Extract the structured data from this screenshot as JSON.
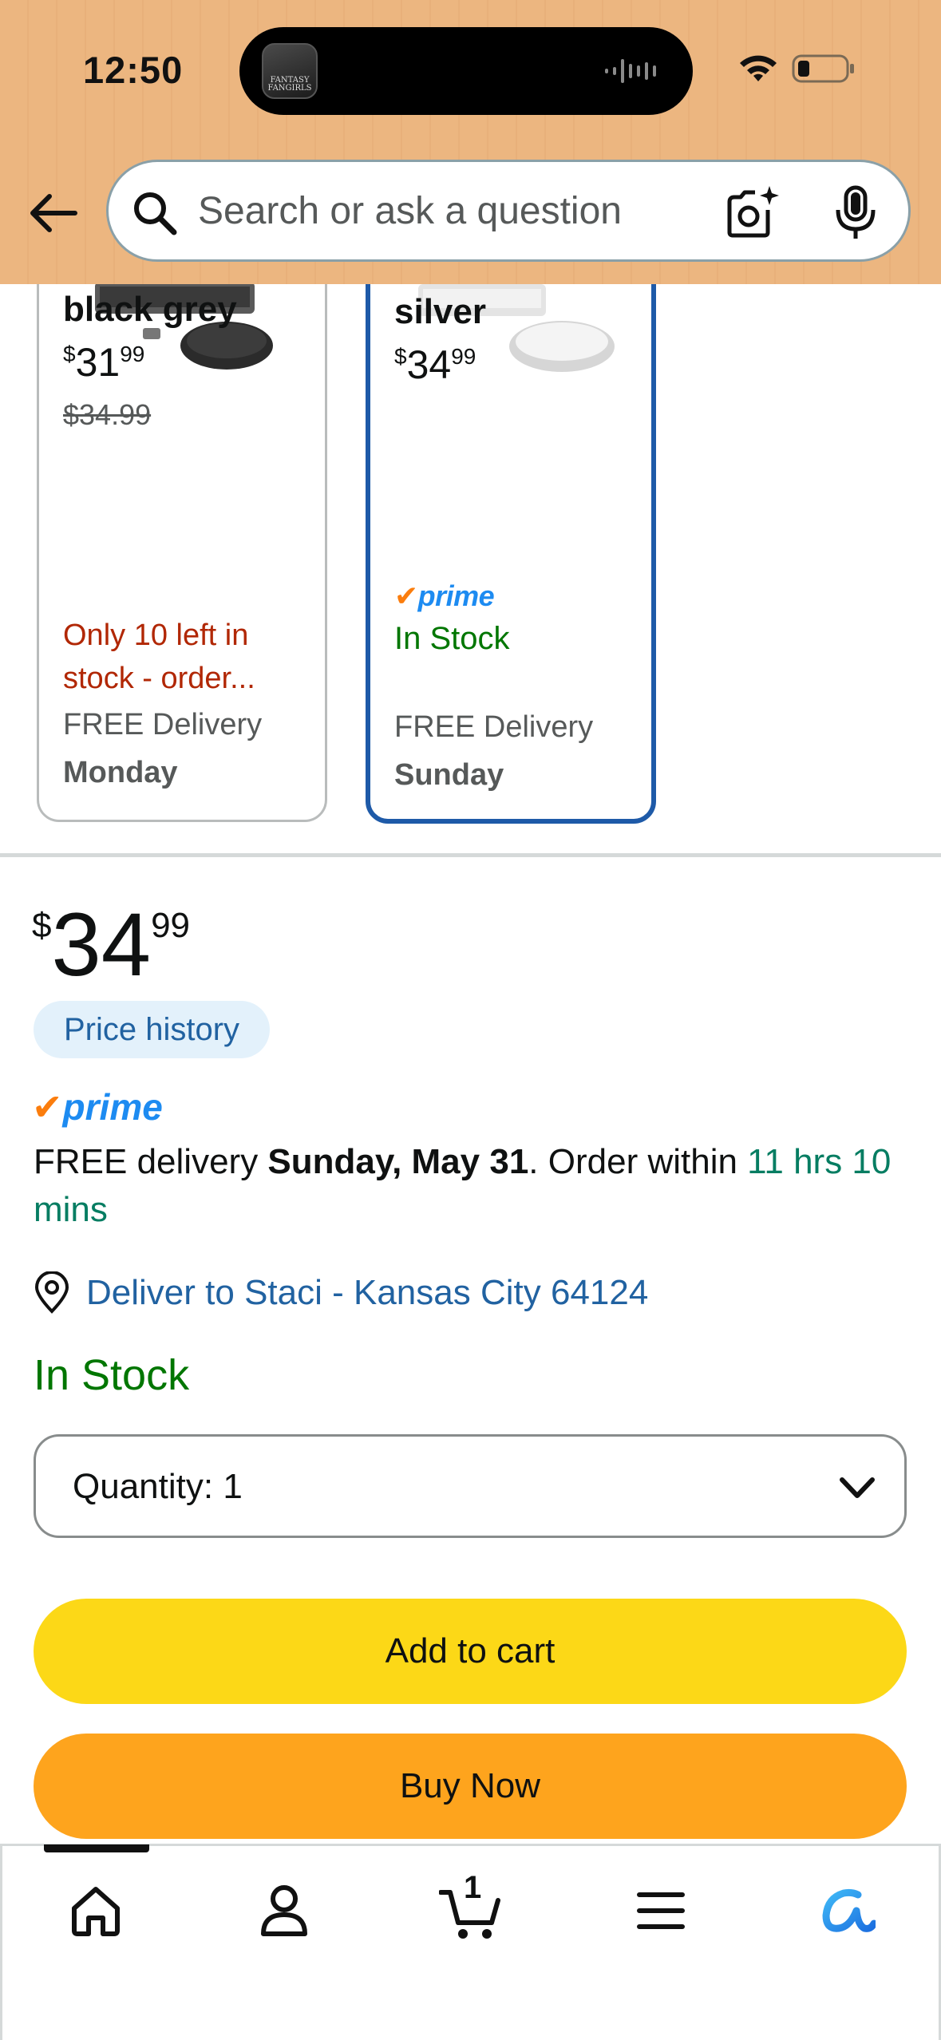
{
  "status_bar": {
    "time": "12:50",
    "island_app_label": "FANTASY FANGIRLS"
  },
  "search": {
    "placeholder": "Search or ask a question"
  },
  "variants": [
    {
      "name": "black grey",
      "price_whole": "31",
      "price_fraction": "99",
      "price_currency": "$",
      "list_price": "$34.99",
      "stock_note": "Only 10 left in stock - order...",
      "delivery_label": "FREE Delivery",
      "delivery_day": "Monday",
      "selected": false
    },
    {
      "name": "silver",
      "price_whole": "34",
      "price_fraction": "99",
      "price_currency": "$",
      "badge": "prime",
      "stock_note": "In Stock",
      "delivery_label": "FREE Delivery",
      "delivery_day": "Sunday",
      "selected": true
    }
  ],
  "buybox": {
    "currency": "$",
    "price_whole": "34",
    "price_fraction": "99",
    "price_history_label": "Price history",
    "prime_label": "prime",
    "delivery_prefix": "FREE delivery ",
    "delivery_date": "Sunday, May 31",
    "delivery_mid": ". Order within ",
    "delivery_countdown": "11 hrs 10 mins",
    "deliver_to": "Deliver to Staci - Kansas City 64124",
    "stock": "In Stock",
    "quantity_label": "Quantity:",
    "quantity_value": "1",
    "add_to_cart": "Add to cart",
    "buy_now": "Buy Now"
  },
  "bottom_nav": {
    "cart_count": "1",
    "items": [
      "home",
      "account",
      "cart",
      "menu",
      "rufus"
    ]
  },
  "colors": {
    "header_bg": "#ecb680",
    "selected_border": "#1e5aa8",
    "prime_blue": "#1d8bf1",
    "prime_check": "#fb7d0d",
    "in_stock_green": "#007600",
    "low_stock_red": "#b12704",
    "link_blue": "#2162a1",
    "add_to_cart_yellow": "#fcd817",
    "buy_now_orange": "#fea41d"
  }
}
